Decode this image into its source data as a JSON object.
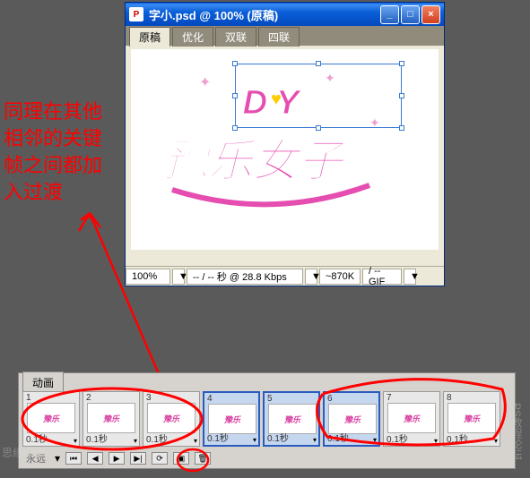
{
  "window": {
    "title": "字小.psd @ 100% (原稿)",
    "tabs": [
      "原稿",
      "优化",
      "双联",
      "四联"
    ],
    "active_tab_index": 0,
    "artwork_caption": "豫乐女子 DIY"
  },
  "status": {
    "zoom": "100%",
    "zoom_dd": "▼",
    "info": "-- / -- 秒 @ 28.8 Kbps",
    "info_dd": "▼",
    "size": "~870K",
    "format": "/ -- GIF",
    "format_dd": "▼"
  },
  "annotation": {
    "line1": "同理在其他",
    "line2": "相邻的关键",
    "line3": "帧之间都加",
    "line4": "入过渡"
  },
  "animation": {
    "panel_title": "动画",
    "loop_text": "永远",
    "frames": [
      {
        "num": "1",
        "delay": "0.1秒",
        "selected": false
      },
      {
        "num": "2",
        "delay": "0.1秒",
        "selected": false
      },
      {
        "num": "3",
        "delay": "0.1秒",
        "selected": false
      },
      {
        "num": "4",
        "delay": "0.1秒",
        "selected": true
      },
      {
        "num": "5",
        "delay": "0.1秒",
        "selected": true
      },
      {
        "num": "6",
        "delay": "0.1秒",
        "selected": true
      },
      {
        "num": "7",
        "delay": "0.1秒",
        "selected": false
      },
      {
        "num": "8",
        "delay": "0.1秒",
        "selected": false
      }
    ],
    "dd": "▾"
  },
  "watermark": {
    "left": "思缘设计",
    "right": "PS教程论坛"
  },
  "colors": {
    "titlebar": "#0a5fd8",
    "annotation_red": "#ff0000",
    "artwork_pink": "#e54db0",
    "selected_frame": "#2a5cc0"
  }
}
